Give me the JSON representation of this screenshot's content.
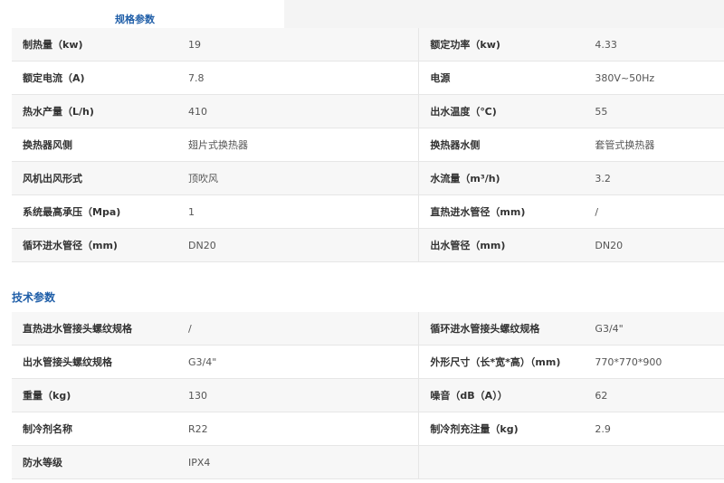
{
  "tab": {
    "label": "规格参数"
  },
  "spec_rows": [
    {
      "l1": "制热量（kw)",
      "v1": "19",
      "l2": "额定功率（kw)",
      "v2": "4.33"
    },
    {
      "l1": "额定电流（A)",
      "v1": "7.8",
      "l2": "电源",
      "v2": "380V~50Hz"
    },
    {
      "l1": "热水产量（L/h)",
      "v1": "410",
      "l2": "出水温度（℃)",
      "v2": "55"
    },
    {
      "l1": "换热器风侧",
      "v1": "翅片式换热器",
      "l2": "换热器水侧",
      "v2": "套管式换热器"
    },
    {
      "l1": "风机出风形式",
      "v1": "顶吹风",
      "l2": "水流量（m³/h)",
      "v2": "3.2"
    },
    {
      "l1": "系统最高承压（Mpa)",
      "v1": "1",
      "l2": "直热进水管径（mm)",
      "v2": "/"
    },
    {
      "l1": "循环进水管径（mm)",
      "v1": "DN20",
      "l2": "出水管径（mm)",
      "v2": "DN20"
    }
  ],
  "tech_section": {
    "title": "技术参数"
  },
  "tech_rows": [
    {
      "l1": "直热进水管接头螺纹规格",
      "v1": "/",
      "l2": "循环进水管接头螺纹规格",
      "v2": "G3/4\""
    },
    {
      "l1": "出水管接头螺纹规格",
      "v1": "G3/4\"",
      "l2": "外形尺寸（长*宽*高）（mm)",
      "v2": "770*770*900"
    },
    {
      "l1": "重量（kg)",
      "v1": "130",
      "l2": "噪音（dB（A））",
      "v2": "62"
    },
    {
      "l1": "制冷剂名称",
      "v1": "R22",
      "l2": "制冷剂充注量（kg)",
      "v2": "2.9"
    },
    {
      "l1": "防水等级",
      "v1": "IPX4",
      "l2": "",
      "v2": ""
    }
  ]
}
